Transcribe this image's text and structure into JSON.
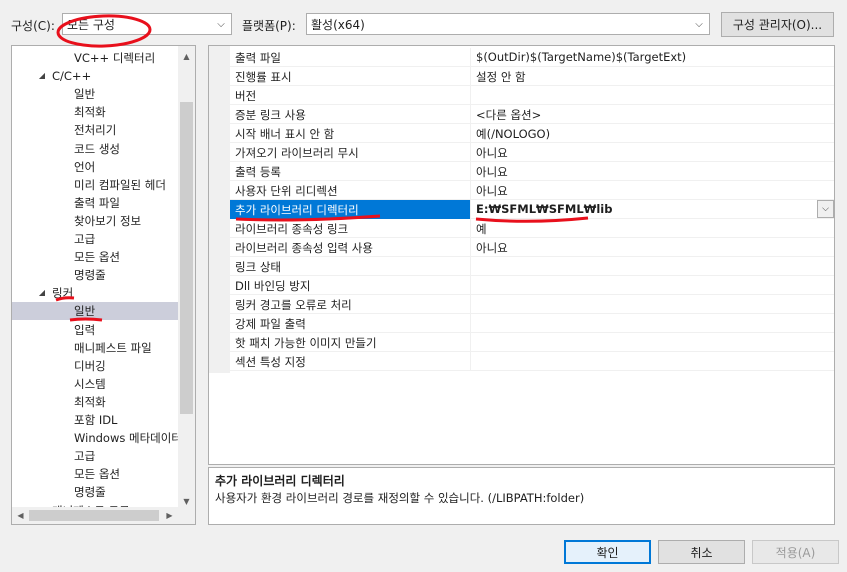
{
  "config": {
    "label": "구성(C):",
    "value": "모든 구성"
  },
  "platform": {
    "label": "플랫폼(P):",
    "value": "활성(x64)"
  },
  "config_manager_label": "구성 관리자(O)...",
  "tree": [
    {
      "label": "VC++ 디렉터리",
      "level": 1
    },
    {
      "label": "C/C++",
      "level": 0,
      "expanded": true
    },
    {
      "label": "일반",
      "level": 1
    },
    {
      "label": "최적화",
      "level": 1
    },
    {
      "label": "전처리기",
      "level": 1
    },
    {
      "label": "코드 생성",
      "level": 1
    },
    {
      "label": "언어",
      "level": 1
    },
    {
      "label": "미리 컴파일된 헤더",
      "level": 1
    },
    {
      "label": "출력 파일",
      "level": 1
    },
    {
      "label": "찾아보기 정보",
      "level": 1
    },
    {
      "label": "고급",
      "level": 1
    },
    {
      "label": "모든 옵션",
      "level": 1
    },
    {
      "label": "명령줄",
      "level": 1
    },
    {
      "label": "링커",
      "level": 0,
      "expanded": true
    },
    {
      "label": "일반",
      "level": 1,
      "selected": true
    },
    {
      "label": "입력",
      "level": 1
    },
    {
      "label": "매니페스트 파일",
      "level": 1
    },
    {
      "label": "디버깅",
      "level": 1
    },
    {
      "label": "시스템",
      "level": 1
    },
    {
      "label": "최적화",
      "level": 1
    },
    {
      "label": "포함 IDL",
      "level": 1
    },
    {
      "label": "Windows 메타데이터",
      "level": 1
    },
    {
      "label": "고급",
      "level": 1
    },
    {
      "label": "모든 옵션",
      "level": 1
    },
    {
      "label": "명령줄",
      "level": 1
    },
    {
      "label": "매니페스트 도구",
      "level": 0,
      "expanded": false
    }
  ],
  "properties": [
    {
      "name": "출력 파일",
      "value": "$(OutDir)$(TargetName)$(TargetExt)"
    },
    {
      "name": "진행률 표시",
      "value": "설정 안 함"
    },
    {
      "name": "버전",
      "value": ""
    },
    {
      "name": "증분 링크 사용",
      "value": "<다른 옵션>"
    },
    {
      "name": "시작 배너 표시 안 함",
      "value": "예(/NOLOGO)"
    },
    {
      "name": "가져오기 라이브러리 무시",
      "value": "아니요"
    },
    {
      "name": "출력 등록",
      "value": "아니요"
    },
    {
      "name": "사용자 단위 리디렉션",
      "value": "아니요"
    },
    {
      "name": "추가 라이브러리 디렉터리",
      "value": "E:₩SFML₩SFML₩lib",
      "selected": true
    },
    {
      "name": "라이브러리 종속성 링크",
      "value": "예"
    },
    {
      "name": "라이브러리 종속성 입력 사용",
      "value": "아니요"
    },
    {
      "name": "링크 상태",
      "value": ""
    },
    {
      "name": "Dll 바인딩 방지",
      "value": ""
    },
    {
      "name": "링커 경고를 오류로 처리",
      "value": ""
    },
    {
      "name": "강제 파일 출력",
      "value": ""
    },
    {
      "name": "핫 패치 가능한 이미지 만들기",
      "value": ""
    },
    {
      "name": "섹션 특성 지정",
      "value": ""
    }
  ],
  "description": {
    "title": "추가 라이브러리 디렉터리",
    "text": "사용자가 환경 라이브러리 경로를 재정의할 수 있습니다. (/LIBPATH:folder)"
  },
  "buttons": {
    "ok": "확인",
    "cancel": "취소",
    "apply": "적용(A)"
  },
  "colors": {
    "selection": "#0078d7",
    "annotation": "#e8101c",
    "tree_selection": "#cccedb"
  },
  "icons": {
    "dropdown": "chevron-down-icon",
    "expand": "triangle-down-icon",
    "collapse": "triangle-right-icon"
  }
}
